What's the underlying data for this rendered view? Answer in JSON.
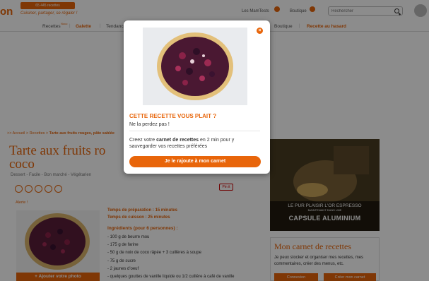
{
  "header": {
    "logo_text": "on",
    "recipe_count": "65 445 recettes",
    "tagline": "Cuisiner, partager, se régaler !",
    "links": [
      "Les MamTests",
      "Boutique"
    ],
    "search_placeholder": "Rechercher"
  },
  "nav": {
    "items": [
      "Recettes",
      "Galette",
      "Tendances",
      "Boutique",
      "Recette au hasard"
    ],
    "badge_new": "Nouv."
  },
  "breadcrumb": {
    "items": [
      ">> Accueil",
      "Recettes"
    ],
    "current": "Tarte aux fruits rouges, pâte sablée"
  },
  "recipe": {
    "title_line1": "Tarte aux fruits ro",
    "title_line2": "coco",
    "meta": "Dessert - Facile - Bon marché - Végétarien",
    "alert_link": "Alerte !",
    "pin_label": "Pin it",
    "add_photo_label": "+ Ajouter votre photo",
    "prep_time": "Temps de préparation : 15 minutes",
    "cook_time": "Temps de cuisson : 25 minutes",
    "ingredients_title": "Ingrédients (pour 6 personnes) :",
    "ingredients": [
      "- 100 g de beurre mou",
      "- 175 g de farine",
      "- 50 g de noix de coco râpée + 3 cuillères à soupe",
      "- 75 g de sucre",
      "- 2 jaunes d'oeuf",
      "- quelques gouttes de vanille liquide ou 1/2 cuillère à café de vanille"
    ]
  },
  "ad": {
    "line1": "LE PUR PLAISIR L'OR ESPRESSO",
    "line2": "MAINTENANT DANS UNE",
    "line3": "CAPSULE ALUMINIUM"
  },
  "carnet": {
    "title": "Mon carnet de recettes",
    "text": "Je peux stocker et organiser mes recettes, mes commentaires, créer des menus, etc.",
    "login_label": "Connexion",
    "create_label": "Créer mon carnet"
  },
  "modal": {
    "heading": "CETTE RECETTE VOUS PLAIT ?",
    "subheading": "Ne la perdez pas !",
    "text_before": "Creez votre ",
    "text_bold": "carnet de recettes",
    "text_after": " en 2 min pour y sauvegarder vos recettes préférées",
    "button_label": "Je le rajoute à mon carnet",
    "close_symbol": "×"
  },
  "colors": {
    "accent": "#e8650a",
    "overlay": "rgba(0,0,0,0.45)"
  }
}
